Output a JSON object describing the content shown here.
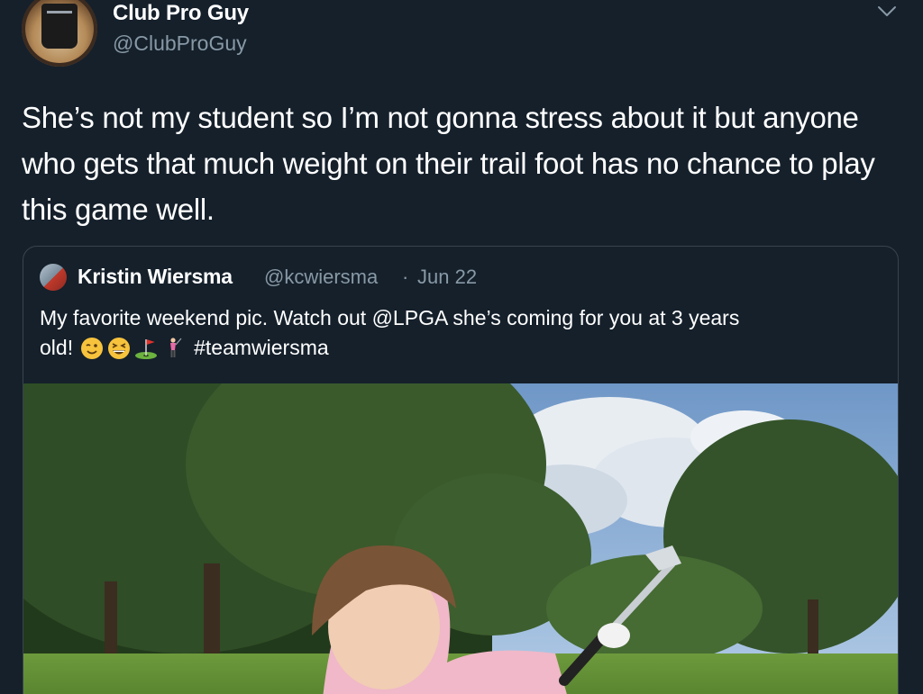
{
  "author": {
    "display_name": "Club Pro Guy",
    "handle": "@ClubProGuy"
  },
  "tweet": {
    "text": "She’s not my student so I’m not gonna stress about it but anyone who gets that much weight on their trail foot has no chance to play this game well."
  },
  "quoted_tweet": {
    "display_name": "Kristin Wiersma",
    "handle": "@kcwiersma",
    "separator": "·",
    "date": "Jun 22",
    "text_line1": "My favorite weekend pic. Watch out @LPGA she’s coming for you at 3 years",
    "text_line2_start": "old!",
    "emojis": [
      "winking-face",
      "grinning-squinting-face",
      "flag-in-hole",
      "woman-golfing"
    ],
    "hashtag": "#teamwiersma"
  },
  "icons": {
    "menu": "chevron-down-icon"
  },
  "colors": {
    "background": "#15202b",
    "text": "#ffffff",
    "secondary_text": "#8899a6",
    "border": "#38444d"
  }
}
